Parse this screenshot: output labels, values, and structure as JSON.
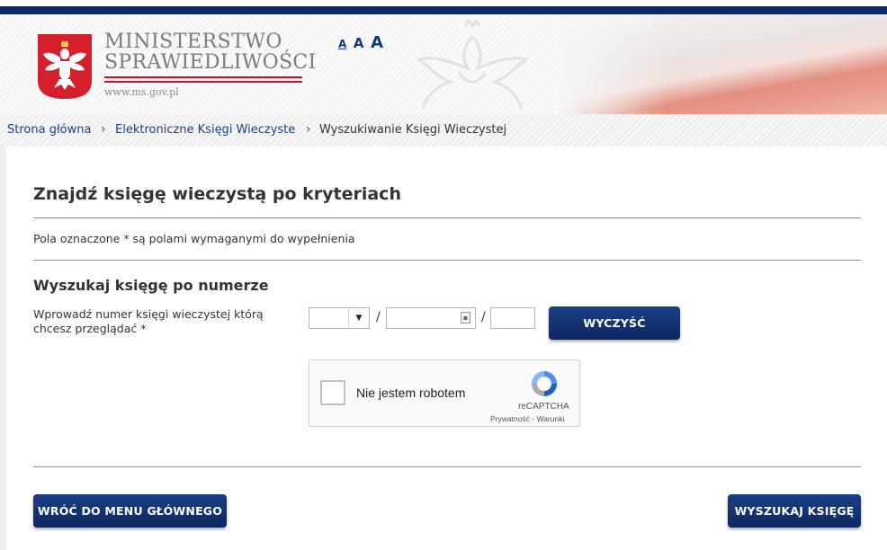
{
  "header": {
    "ministry_line1": "MINISTERSTWO",
    "ministry_line2": "SPRAWIEDLIWOŚCI",
    "url": "www.ms.gov.pl",
    "font_size_options": [
      "A",
      "A",
      "A"
    ]
  },
  "breadcrumb": {
    "items": [
      "Strona główna",
      "Elektroniczne Księgi Wieczyste",
      "Wyszukiwanie Księgi Wieczystej"
    ]
  },
  "main": {
    "title": "Znajdź księgę wieczystą po kryteriach",
    "required_note": "Pola oznaczone * są polami wymaganymi do wypełnienia",
    "section_title": "Wyszukaj księgę po numerze",
    "field_label": "Wprowadź numer księgi wieczystej którą chcesz przeglądać *",
    "court_code": {
      "value": "",
      "selected": ""
    },
    "book_number": {
      "value": "",
      "placeholder": ""
    },
    "check_digit": {
      "value": "",
      "placeholder": ""
    },
    "separator": "/",
    "clear_button": "WYCZYŚĆ",
    "back_button": "WRÓĆ DO MENU GŁÓWNEGO",
    "search_button": "WYSZUKAJ KSIĘGĘ"
  },
  "captcha": {
    "label": "Nie jestem robotem",
    "brand": "reCAPTCHA",
    "terms": "Prywatność - Warunki"
  },
  "colors": {
    "navy": "#0c2b6b",
    "button": "#12357a",
    "link": "#1a3f8f",
    "accent_red": "#c8102e"
  }
}
